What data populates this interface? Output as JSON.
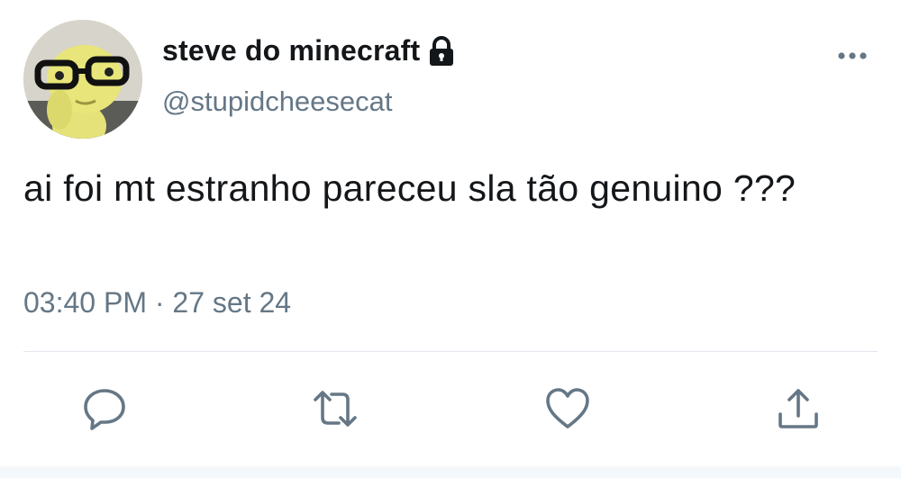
{
  "profile": {
    "display_name": "steve do minecraft",
    "handle": "@stupidcheesecat",
    "protected_icon": "lock-icon",
    "avatar_icon": "avatar-photo"
  },
  "tweet": {
    "text": "ai foi mt estranho pareceu sla tão genuino ???",
    "time": "03:40 PM",
    "separator": "·",
    "date": "27 set 24"
  },
  "menu_icon": "more-options-icon",
  "actions": [
    {
      "icon": "reply-icon"
    },
    {
      "icon": "retweet-icon"
    },
    {
      "icon": "like-icon"
    },
    {
      "icon": "share-icon"
    }
  ],
  "colors": {
    "text_primary": "#14171a",
    "text_secondary": "#657786",
    "divider": "#e1e8ed"
  }
}
